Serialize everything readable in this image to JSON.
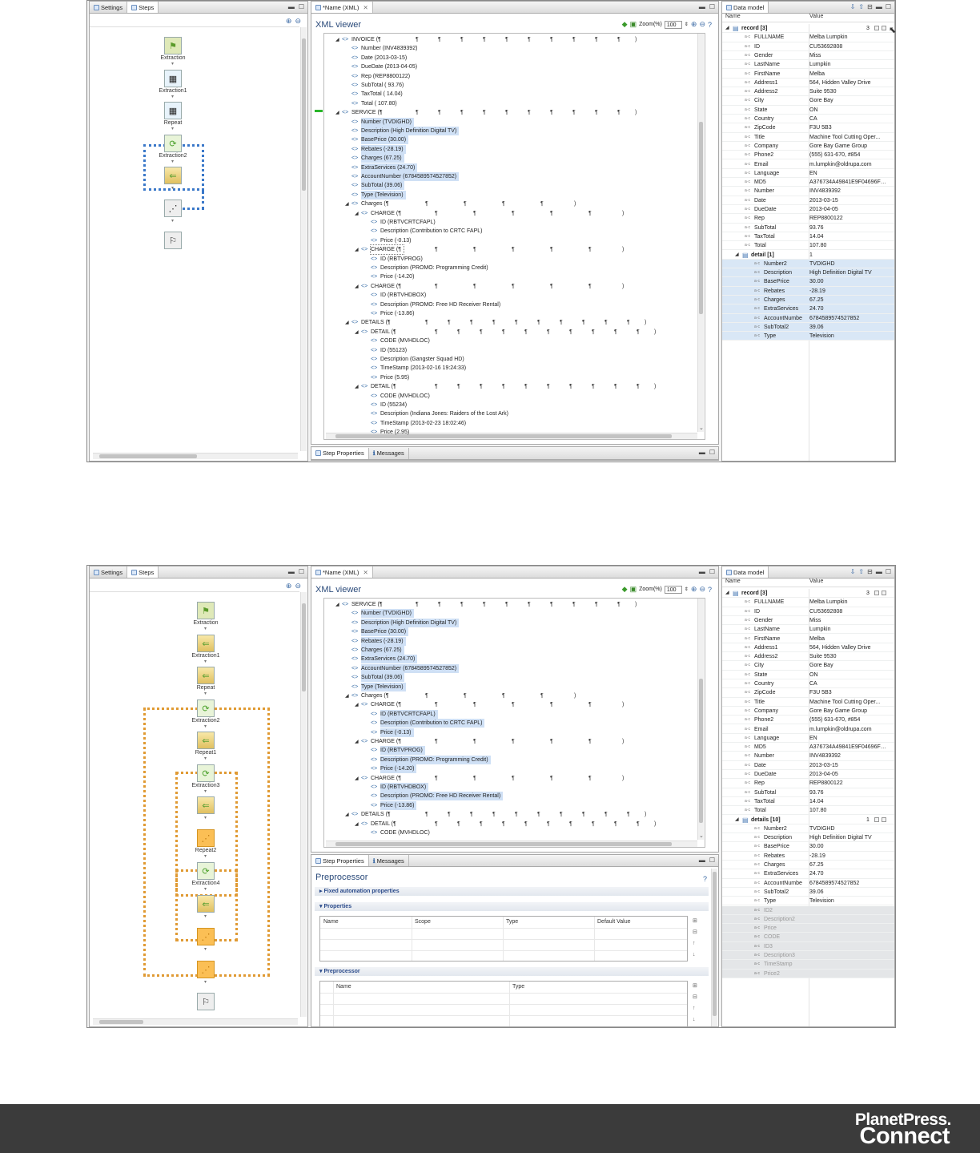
{
  "tabs": {
    "settings": "Settings",
    "steps": "Steps",
    "xml_editor": "*Name (XML)",
    "data_model": "Data model",
    "step_properties": "Step Properties",
    "messages": "Messages"
  },
  "xml_viewer": {
    "title": "XML viewer",
    "zoom_label": "Zoom(%)",
    "zoom_value": "100"
  },
  "data_model": {
    "col_name": "Name",
    "col_value": "Value"
  },
  "screenshot1": {
    "steps": [
      {
        "label": "Extraction",
        "icon": "flag-icon"
      },
      {
        "label": "Extraction1",
        "icon": "extraction-grid-icon"
      },
      {
        "label": "Repeat",
        "icon": "extraction-grid-icon"
      },
      {
        "label": "Extraction2",
        "icon": "repeat-icon"
      },
      {
        "label": "",
        "icon": "extraction-icon"
      },
      {
        "label": "",
        "icon": "goto-icon"
      },
      {
        "label": "",
        "icon": "finish-flag-icon"
      }
    ],
    "xml_rows": [
      {
        "indent": 0,
        "tri": "◢",
        "text": "INVOICE (¶",
        "pil": 10,
        "sel": false
      },
      {
        "indent": 1,
        "tri": "",
        "text": "Number (INV4839392)",
        "sel": false
      },
      {
        "indent": 1,
        "tri": "",
        "text": "Date (2013-03-15)",
        "sel": false
      },
      {
        "indent": 1,
        "tri": "",
        "text": "DueDate (2013-04-05)",
        "sel": false
      },
      {
        "indent": 1,
        "tri": "",
        "text": "Rep (REP8800122)",
        "sel": false
      },
      {
        "indent": 1,
        "tri": "",
        "text": "SubTotal (  93.76)",
        "sel": false
      },
      {
        "indent": 1,
        "tri": "",
        "text": "TaxTotal (    14.04)",
        "sel": false
      },
      {
        "indent": 1,
        "tri": "",
        "text": "Total (  107.80)",
        "sel": false
      },
      {
        "indent": 0,
        "tri": "◢",
        "text": "SERVICE (¶",
        "pil": 10,
        "sel": false
      },
      {
        "indent": 1,
        "tri": "",
        "text": "Number (TVDIGHD)",
        "sel": true
      },
      {
        "indent": 1,
        "tri": "",
        "text": "Description (High Definition Digital TV)",
        "sel": true
      },
      {
        "indent": 1,
        "tri": "",
        "text": "BasePrice (30.00)",
        "sel": true
      },
      {
        "indent": 1,
        "tri": "",
        "text": "Rebates (-28.19)",
        "sel": true
      },
      {
        "indent": 1,
        "tri": "",
        "text": "Charges (67.25)",
        "sel": true
      },
      {
        "indent": 1,
        "tri": "",
        "text": "ExtraServices (24.70)",
        "sel": true
      },
      {
        "indent": 1,
        "tri": "",
        "text": "AccountNumber (6784589574527852)",
        "sel": true
      },
      {
        "indent": 1,
        "tri": "",
        "text": "SubTotal (39.06)",
        "sel": true
      },
      {
        "indent": 1,
        "tri": "",
        "text": "Type (Television)",
        "sel": true
      },
      {
        "indent": 1,
        "tri": "◢",
        "text": "Charges (¶",
        "pil": 4,
        "sel": false
      },
      {
        "indent": 2,
        "tri": "◢",
        "text": "CHARGE (¶",
        "pil": 5,
        "sel": false
      },
      {
        "indent": 3,
        "tri": "",
        "text": "ID (RBTVCRTCFAPL)",
        "sel": false
      },
      {
        "indent": 3,
        "tri": "",
        "text": "Description (Contribution to CRTC FAPL)",
        "sel": false
      },
      {
        "indent": 3,
        "tri": "",
        "text": "Price (-0.13)",
        "sel": false
      },
      {
        "indent": 2,
        "tri": "◢",
        "text": "CHARGE (¶",
        "pil": 5,
        "sel": false,
        "outl": true
      },
      {
        "indent": 3,
        "tri": "",
        "text": "ID (RBTVPROG)",
        "sel": false
      },
      {
        "indent": 3,
        "tri": "",
        "text": "Description (PROMO: Programming Credit)",
        "sel": false
      },
      {
        "indent": 3,
        "tri": "",
        "text": "Price (-14.20)",
        "sel": false
      },
      {
        "indent": 2,
        "tri": "◢",
        "text": "CHARGE (¶",
        "pil": 5,
        "sel": false
      },
      {
        "indent": 3,
        "tri": "",
        "text": "ID (RBTVHDBOX)",
        "sel": false
      },
      {
        "indent": 3,
        "tri": "",
        "text": "Description (PROMO: Free HD Receiver Rental)",
        "sel": false
      },
      {
        "indent": 3,
        "tri": "",
        "text": "Price (-13.86)",
        "sel": false
      },
      {
        "indent": 1,
        "tri": "◢",
        "text": "DETAILS (¶",
        "pil": 10,
        "sel": false
      },
      {
        "indent": 2,
        "tri": "◢",
        "text": "DETAIL (¶",
        "pil": 10,
        "sel": false
      },
      {
        "indent": 3,
        "tri": "",
        "text": "CODE (MVHDLOC)",
        "sel": false
      },
      {
        "indent": 3,
        "tri": "",
        "text": "ID (55123)",
        "sel": false
      },
      {
        "indent": 3,
        "tri": "",
        "text": "Description (Gangster Squad HD)",
        "sel": false
      },
      {
        "indent": 3,
        "tri": "",
        "text": "TimeStamp (2013-02-16 19:24:33)",
        "sel": false
      },
      {
        "indent": 3,
        "tri": "",
        "text": "Price (5.95)",
        "sel": false
      },
      {
        "indent": 2,
        "tri": "◢",
        "text": "DETAIL (¶",
        "pil": 10,
        "sel": false
      },
      {
        "indent": 3,
        "tri": "",
        "text": "CODE (MVHDLOC)",
        "sel": false
      },
      {
        "indent": 3,
        "tri": "",
        "text": "ID (55234)",
        "sel": false
      },
      {
        "indent": 3,
        "tri": "",
        "text": "Description (Indiana Jones: Raiders of the Lost Ark)",
        "sel": false
      },
      {
        "indent": 3,
        "tri": "",
        "text": "TimeStamp (2013-02-23 18:02:46)",
        "sel": false
      },
      {
        "indent": 3,
        "tri": "",
        "text": "Price (2.95)",
        "sel": false
      }
    ],
    "dm_rows": [
      {
        "lvl": 0,
        "name": "record [3]",
        "value": "",
        "bold": true,
        "cnt": "3",
        "table": true
      },
      {
        "lvl": 1,
        "name": "FULLNAME",
        "value": "Melba Lumpkin"
      },
      {
        "lvl": 1,
        "name": "ID",
        "value": "CU53692808"
      },
      {
        "lvl": 1,
        "name": "Gender",
        "value": "Miss"
      },
      {
        "lvl": 1,
        "name": "LastName",
        "value": "Lumpkin"
      },
      {
        "lvl": 1,
        "name": "FirstName",
        "value": "Melba"
      },
      {
        "lvl": 1,
        "name": "Address1",
        "value": "564, Hidden Valley Drive"
      },
      {
        "lvl": 1,
        "name": "Address2",
        "value": "Suite 9530"
      },
      {
        "lvl": 1,
        "name": "City",
        "value": "Gore Bay"
      },
      {
        "lvl": 1,
        "name": "State",
        "value": "ON"
      },
      {
        "lvl": 1,
        "name": "Country",
        "value": "CA"
      },
      {
        "lvl": 1,
        "name": "ZipCode",
        "value": "F3U 5B3"
      },
      {
        "lvl": 1,
        "name": "Title",
        "value": "Machine Tool Cutting Oper..."
      },
      {
        "lvl": 1,
        "name": "Company",
        "value": "Gore Bay Game Group"
      },
      {
        "lvl": 1,
        "name": "Phone2",
        "value": "(555) 631-670, #854"
      },
      {
        "lvl": 1,
        "name": "Email",
        "value": "m.lumpkin@oldrupa.com"
      },
      {
        "lvl": 1,
        "name": "Language",
        "value": "EN"
      },
      {
        "lvl": 1,
        "name": "MD5",
        "value": "A376734A49841E9F04696F8E..."
      },
      {
        "lvl": 1,
        "name": "Number",
        "value": "INV4839392"
      },
      {
        "lvl": 1,
        "name": "Date",
        "value": "2013-03-15"
      },
      {
        "lvl": 1,
        "name": "DueDate",
        "value": "2013-04-05"
      },
      {
        "lvl": 1,
        "name": "Rep",
        "value": "REP8800122"
      },
      {
        "lvl": 1,
        "name": "SubTotal",
        "value": "93.76"
      },
      {
        "lvl": 1,
        "name": "TaxTotal",
        "value": "14.04"
      },
      {
        "lvl": 1,
        "name": "Total",
        "value": "107.80"
      },
      {
        "lvl": 1,
        "name": "detail [1]",
        "value": "1",
        "bold": true,
        "table": true
      },
      {
        "lvl": 2,
        "name": "Number2",
        "value": "TVDIGHD",
        "sel": true
      },
      {
        "lvl": 2,
        "name": "Description",
        "value": "High Definition Digital TV",
        "sel": true
      },
      {
        "lvl": 2,
        "name": "BasePrice",
        "value": "30.00",
        "sel": true
      },
      {
        "lvl": 2,
        "name": "Rebates",
        "value": "-28.19",
        "sel": true
      },
      {
        "lvl": 2,
        "name": "Charges",
        "value": "67.25",
        "sel": true
      },
      {
        "lvl": 2,
        "name": "ExtraServices",
        "value": "24.70",
        "sel": true
      },
      {
        "lvl": 2,
        "name": "AccountNumbe",
        "value": "6784589574527852",
        "sel": true
      },
      {
        "lvl": 2,
        "name": "SubTotal2",
        "value": "39.06",
        "sel": true
      },
      {
        "lvl": 2,
        "name": "Type",
        "value": "Television",
        "sel": true
      }
    ]
  },
  "screenshot2": {
    "steps": [
      {
        "label": "Extraction",
        "icon": "flag-icon"
      },
      {
        "label": "Extraction1",
        "icon": "extraction-icon"
      },
      {
        "label": "Repeat",
        "icon": "extraction-icon"
      },
      {
        "label": "Extraction2",
        "icon": "repeat-icon"
      },
      {
        "label": "Repeat1",
        "icon": "extraction-icon"
      },
      {
        "label": "Extraction3",
        "icon": "repeat-icon"
      },
      {
        "label": "",
        "icon": "extraction-icon"
      },
      {
        "label": "Repeat2",
        "icon": "goto-icon"
      },
      {
        "label": "Extraction4",
        "icon": "repeat-icon"
      },
      {
        "label": "",
        "icon": "extraction-icon"
      },
      {
        "label": "",
        "icon": "goto-icon"
      },
      {
        "label": "",
        "icon": "goto-icon"
      },
      {
        "label": "",
        "icon": "finish-flag-icon"
      }
    ],
    "xml_rows": [
      {
        "indent": 0,
        "tri": "◢",
        "text": "SERVICE (¶",
        "pil": 10,
        "sel": false
      },
      {
        "indent": 1,
        "tri": "",
        "text": "Number (TVDIGHD)",
        "sel": true
      },
      {
        "indent": 1,
        "tri": "",
        "text": "Description (High Definition Digital TV)",
        "sel": true
      },
      {
        "indent": 1,
        "tri": "",
        "text": "BasePrice (30.00)",
        "sel": true
      },
      {
        "indent": 1,
        "tri": "",
        "text": "Rebates (-28.19)",
        "sel": true
      },
      {
        "indent": 1,
        "tri": "",
        "text": "Charges (67.25)",
        "sel": true
      },
      {
        "indent": 1,
        "tri": "",
        "text": "ExtraServices (24.70)",
        "sel": true
      },
      {
        "indent": 1,
        "tri": "",
        "text": "AccountNumber (6784589574527852)",
        "sel": true
      },
      {
        "indent": 1,
        "tri": "",
        "text": "SubTotal (39.06)",
        "sel": true
      },
      {
        "indent": 1,
        "tri": "",
        "text": "Type (Television)",
        "sel": true
      },
      {
        "indent": 1,
        "tri": "◢",
        "text": "Charges (¶",
        "pil": 4,
        "sel": false
      },
      {
        "indent": 2,
        "tri": "◢",
        "text": "CHARGE (¶",
        "pil": 5,
        "sel": false
      },
      {
        "indent": 3,
        "tri": "",
        "text": "ID (RBTVCRTCFAPL)",
        "sel": true
      },
      {
        "indent": 3,
        "tri": "",
        "text": "Description (Contribution to CRTC FAPL)",
        "sel": true
      },
      {
        "indent": 3,
        "tri": "",
        "text": "Price (-0.13)",
        "sel": true
      },
      {
        "indent": 2,
        "tri": "◢",
        "text": "CHARGE (¶",
        "pil": 5,
        "sel": false
      },
      {
        "indent": 3,
        "tri": "",
        "text": "ID (RBTVPROG)",
        "sel": true
      },
      {
        "indent": 3,
        "tri": "",
        "text": "Description (PROMO: Programming Credit)",
        "sel": true
      },
      {
        "indent": 3,
        "tri": "",
        "text": "Price (-14.20)",
        "sel": true
      },
      {
        "indent": 2,
        "tri": "◢",
        "text": "CHARGE (¶",
        "pil": 5,
        "sel": false
      },
      {
        "indent": 3,
        "tri": "",
        "text": "ID (RBTVHDBOX)",
        "sel": true
      },
      {
        "indent": 3,
        "tri": "",
        "text": "Description (PROMO: Free HD Receiver Rental)",
        "sel": true
      },
      {
        "indent": 3,
        "tri": "",
        "text": "Price (-13.86)",
        "sel": true
      },
      {
        "indent": 1,
        "tri": "◢",
        "text": "DETAILS (¶",
        "pil": 10,
        "sel": false
      },
      {
        "indent": 2,
        "tri": "◢",
        "text": "DETAIL (¶",
        "pil": 10,
        "sel": false
      },
      {
        "indent": 3,
        "tri": "",
        "text": "CODE (MVHDLOC)",
        "sel": false
      }
    ],
    "dm_rows": [
      {
        "lvl": 0,
        "name": "record [3]",
        "value": "",
        "bold": true,
        "cnt": "3",
        "table": true
      },
      {
        "lvl": 1,
        "name": "FULLNAME",
        "value": "Melba Lumpkin"
      },
      {
        "lvl": 1,
        "name": "ID",
        "value": "CU53692808"
      },
      {
        "lvl": 1,
        "name": "Gender",
        "value": "Miss"
      },
      {
        "lvl": 1,
        "name": "LastName",
        "value": "Lumpkin"
      },
      {
        "lvl": 1,
        "name": "FirstName",
        "value": "Melba"
      },
      {
        "lvl": 1,
        "name": "Address1",
        "value": "564, Hidden Valley Drive"
      },
      {
        "lvl": 1,
        "name": "Address2",
        "value": "Suite 9530"
      },
      {
        "lvl": 1,
        "name": "City",
        "value": "Gore Bay"
      },
      {
        "lvl": 1,
        "name": "State",
        "value": "ON"
      },
      {
        "lvl": 1,
        "name": "Country",
        "value": "CA"
      },
      {
        "lvl": 1,
        "name": "ZipCode",
        "value": "F3U 5B3"
      },
      {
        "lvl": 1,
        "name": "Title",
        "value": "Machine Tool Cutting Oper..."
      },
      {
        "lvl": 1,
        "name": "Company",
        "value": "Gore Bay Game Group"
      },
      {
        "lvl": 1,
        "name": "Phone2",
        "value": "(555) 631-670, #854"
      },
      {
        "lvl": 1,
        "name": "Email",
        "value": "m.lumpkin@oldrupa.com"
      },
      {
        "lvl": 1,
        "name": "Language",
        "value": "EN"
      },
      {
        "lvl": 1,
        "name": "MD5",
        "value": "A376734A49841E9F04696F8E..."
      },
      {
        "lvl": 1,
        "name": "Number",
        "value": "INV4839392"
      },
      {
        "lvl": 1,
        "name": "Date",
        "value": "2013-03-15"
      },
      {
        "lvl": 1,
        "name": "DueDate",
        "value": "2013-04-05"
      },
      {
        "lvl": 1,
        "name": "Rep",
        "value": "REP8800122"
      },
      {
        "lvl": 1,
        "name": "SubTotal",
        "value": "93.76"
      },
      {
        "lvl": 1,
        "name": "TaxTotal",
        "value": "14.04"
      },
      {
        "lvl": 1,
        "name": "Total",
        "value": "107.80"
      },
      {
        "lvl": 1,
        "name": "details [10]",
        "value": "",
        "bold": true,
        "cnt": "1",
        "table": true
      },
      {
        "lvl": 2,
        "name": "Number2",
        "value": "TVDIGHD"
      },
      {
        "lvl": 2,
        "name": "Description",
        "value": "High Definition Digital TV"
      },
      {
        "lvl": 2,
        "name": "BasePrice",
        "value": "30.00"
      },
      {
        "lvl": 2,
        "name": "Rebates",
        "value": "-28.19"
      },
      {
        "lvl": 2,
        "name": "Charges",
        "value": "67.25"
      },
      {
        "lvl": 2,
        "name": "ExtraServices",
        "value": "24.70"
      },
      {
        "lvl": 2,
        "name": "AccountNumbe",
        "value": "6784589574527852"
      },
      {
        "lvl": 2,
        "name": "SubTotal2",
        "value": "39.06"
      },
      {
        "lvl": 2,
        "name": "Type",
        "value": "Television"
      },
      {
        "lvl": 2,
        "name": "ID2",
        "value": "",
        "grey": true
      },
      {
        "lvl": 2,
        "name": "Description2",
        "value": "",
        "grey": true
      },
      {
        "lvl": 2,
        "name": "Price",
        "value": "",
        "grey": true
      },
      {
        "lvl": 2,
        "name": "CODE",
        "value": "",
        "grey": true
      },
      {
        "lvl": 2,
        "name": "ID3",
        "value": "",
        "grey": true
      },
      {
        "lvl": 2,
        "name": "Description3",
        "value": "",
        "grey": true
      },
      {
        "lvl": 2,
        "name": "TimeStamp",
        "value": "",
        "grey": true
      },
      {
        "lvl": 2,
        "name": "Price2",
        "value": "",
        "grey": true
      }
    ],
    "properties": {
      "title": "Preprocessor",
      "fixed_automation": "Fixed automation properties",
      "properties_section": "Properties",
      "prop_cols": [
        "Name",
        "Scope",
        "Type",
        "Default Value"
      ],
      "preprocessor_section": "Preprocessor",
      "pre_cols": [
        "Name",
        "Type"
      ]
    }
  },
  "brand": {
    "line1": "PlanetPress.",
    "line2": "Connect"
  },
  "colors": {
    "selection": "#cfe0f5",
    "loop_blue": "#3a78c9",
    "loop_orange": "#e09a33",
    "banner": "#3b3b3b"
  }
}
